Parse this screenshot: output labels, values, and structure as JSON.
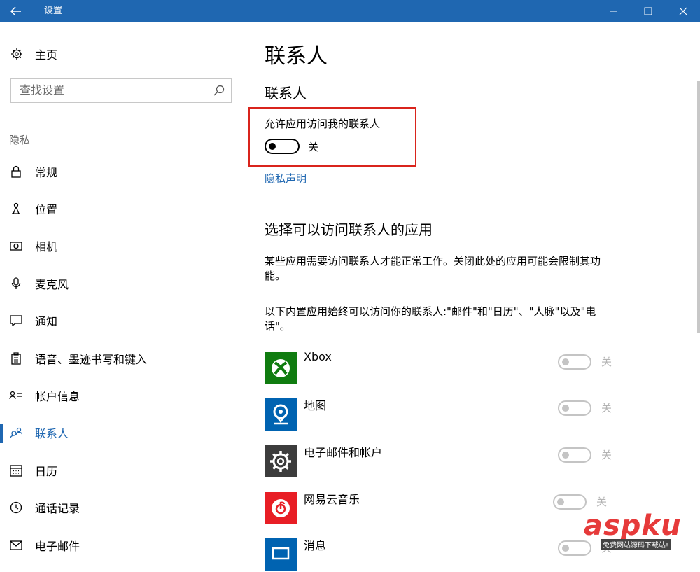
{
  "window": {
    "title": "设置"
  },
  "sidebar": {
    "home_label": "主页",
    "search_placeholder": "查找设置",
    "section_label": "隐私",
    "items": [
      {
        "label": "常规",
        "icon": "lock-icon"
      },
      {
        "label": "位置",
        "icon": "location-icon"
      },
      {
        "label": "相机",
        "icon": "camera-icon"
      },
      {
        "label": "麦克风",
        "icon": "microphone-icon"
      },
      {
        "label": "通知",
        "icon": "notification-icon"
      },
      {
        "label": "语音、墨迹书写和键入",
        "icon": "clipboard-icon"
      },
      {
        "label": "帐户信息",
        "icon": "account-info-icon"
      },
      {
        "label": "联系人",
        "icon": "contacts-icon",
        "active": true
      },
      {
        "label": "日历",
        "icon": "calendar-icon"
      },
      {
        "label": "通话记录",
        "icon": "call-history-icon"
      },
      {
        "label": "电子邮件",
        "icon": "email-icon"
      }
    ]
  },
  "main": {
    "title": "联系人",
    "section1_heading": "联系人",
    "allow_label": "允许应用访问我的联系人",
    "allow_toggle_state": "关",
    "privacy_link": "隐私声明",
    "section2_heading": "选择可以访问联系人的应用",
    "desc1": "某些应用需要访问联系人才能正常工作。关闭此处的应用可能会限制其功能。",
    "desc2": "以下内置应用始终可以访问你的联系人:\"邮件\"和\"日历\"、\"人脉\"以及\"电话\"。",
    "apps": [
      {
        "name": "Xbox",
        "state": "关",
        "tile_color": "#107c10"
      },
      {
        "name": "地图",
        "state": "关",
        "tile_color": "#0063b1"
      },
      {
        "name": "电子邮件和帐户",
        "state": "关",
        "tile_color": "#3c3c3c"
      },
      {
        "name": "网易云音乐",
        "state": "关",
        "tile_color": "#e81e25"
      },
      {
        "name": "消息",
        "state": "关",
        "tile_color": "#0063b1"
      }
    ]
  },
  "watermark": {
    "text": "aspku",
    "subtext": "免费网站源码下载站!"
  },
  "colors": {
    "accent": "#1f67b1",
    "highlight_border": "#d9241c"
  }
}
